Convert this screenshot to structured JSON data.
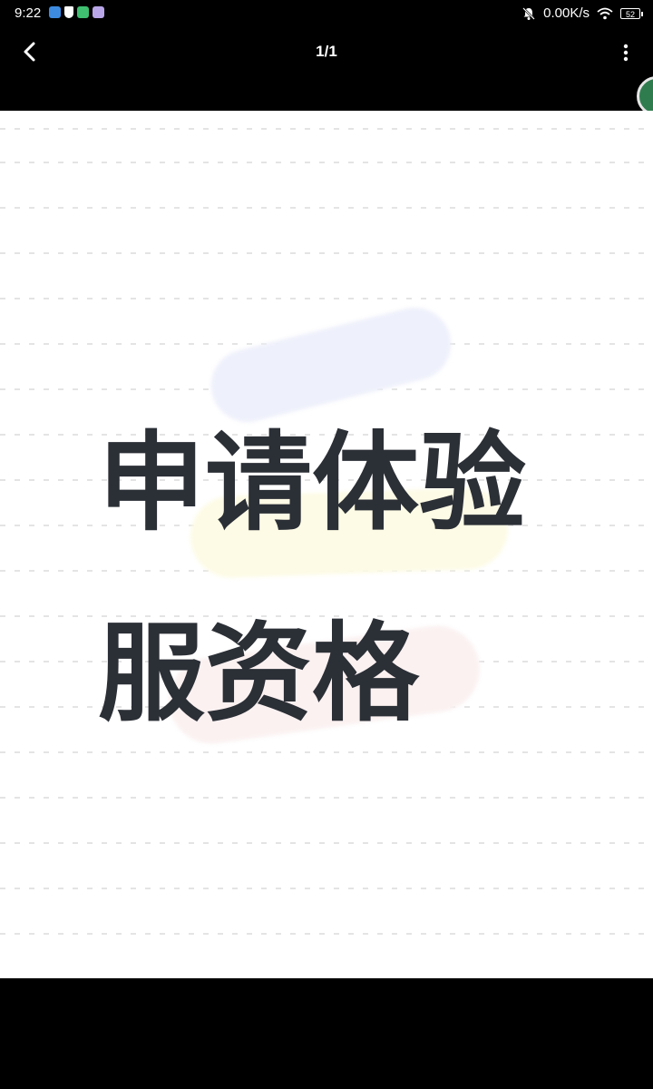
{
  "status_bar": {
    "time": "9:22",
    "network_speed": "0.00K/s",
    "battery_level": "52"
  },
  "toolbar": {
    "page_indicator": "1/1"
  },
  "image": {
    "headline_line1": "申请体验",
    "headline_line2": "服资格"
  },
  "colors": {
    "background": "#000000",
    "image_background": "#ffffff",
    "headline_text": "#2b2f36"
  },
  "icons": {
    "back": "chevron-left-icon",
    "more": "vertical-dots-icon",
    "mute": "bell-slash-icon",
    "wifi": "wifi-icon",
    "battery": "battery-icon"
  }
}
